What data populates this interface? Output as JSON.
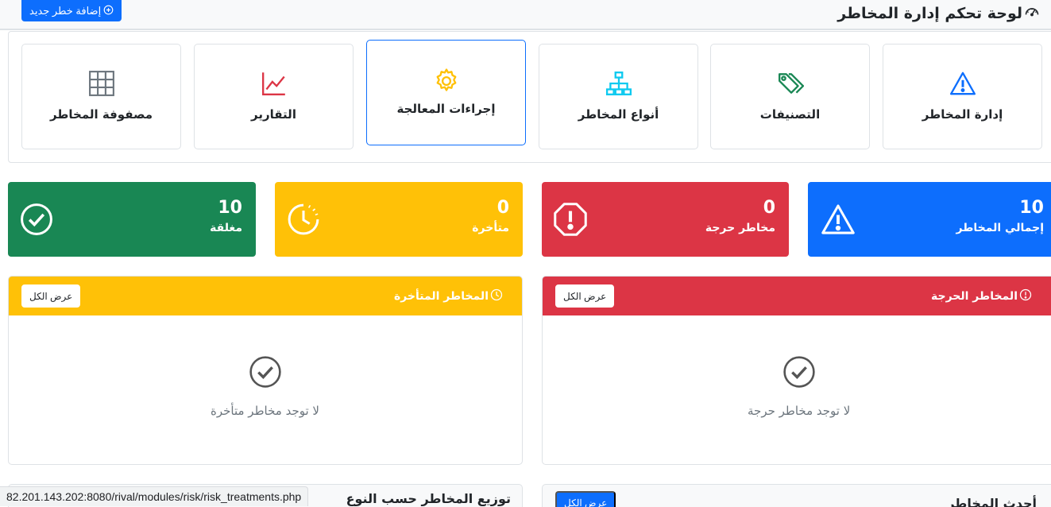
{
  "header": {
    "title": "لوحة تحكم إدارة المخاطر",
    "title_icon": "speedometer-icon",
    "add_button_label": "إضافة خطر جديد",
    "add_button_icon": "plus-circle-icon"
  },
  "nav": {
    "items": [
      {
        "label": "إدارة المخاطر",
        "icon": "warning-triangle-icon",
        "color": "#0d6efd"
      },
      {
        "label": "التصنيفات",
        "icon": "tags-icon",
        "color": "#198754"
      },
      {
        "label": "أنواع المخاطر",
        "icon": "diagram-icon",
        "color": "#0dcaf0"
      },
      {
        "label": "إجراءات المعالجة",
        "icon": "gear-icon",
        "color": "#ffc107",
        "active": true
      },
      {
        "label": "التقارير",
        "icon": "line-chart-icon",
        "color": "#dc3545"
      },
      {
        "label": "مصفوفة المخاطر",
        "icon": "grid-icon",
        "color": "#6c757d"
      }
    ]
  },
  "stats": [
    {
      "value": "10",
      "label": "إجمالي المخاطر",
      "icon": "warning-triangle-icon",
      "color": "#0d6efd"
    },
    {
      "value": "0",
      "label": "مخاطر حرجة",
      "icon": "exclamation-octagon-icon",
      "color": "#dc3545"
    },
    {
      "value": "0",
      "label": "متأخرة",
      "icon": "clock-history-icon",
      "color": "#ffc107"
    },
    {
      "value": "10",
      "label": "مغلقة",
      "icon": "check-circle-icon",
      "color": "#198754"
    }
  ],
  "panels": {
    "critical": {
      "title": "المخاطر الحرجة",
      "icon": "exclamation-circle-icon",
      "view_all": "عرض الكل",
      "empty_icon": "check-circle-icon",
      "empty_text": "لا توجد مخاطر حرجة",
      "color": "#dc3545"
    },
    "overdue": {
      "title": "المخاطر المتأخرة",
      "icon": "clock-icon",
      "view_all": "عرض الكل",
      "empty_icon": "check-circle-icon",
      "empty_text": "لا توجد مخاطر متأخرة",
      "color": "#ffc107"
    }
  },
  "bottom": {
    "latest_title": "أحدث المخاطر",
    "latest_button": "عرض الكل",
    "distribution_title": "توزيع المخاطر حسب النوع"
  },
  "status_bar": {
    "url": "82.201.143.202:8080/rival/modules/risk/risk_treatments.php"
  }
}
